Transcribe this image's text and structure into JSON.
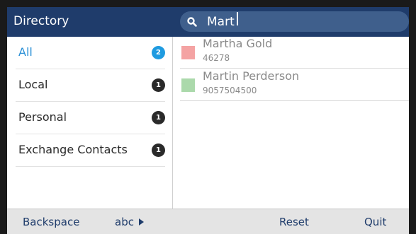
{
  "header": {
    "title": "Directory"
  },
  "search": {
    "value": "Mart",
    "icon": "search-icon"
  },
  "sidebar": {
    "items": [
      {
        "label": "All",
        "count": "2",
        "active": true
      },
      {
        "label": "Local",
        "count": "1",
        "active": false
      },
      {
        "label": "Personal",
        "count": "1",
        "active": false
      },
      {
        "label": "Exchange Contacts",
        "count": "1",
        "active": false
      }
    ]
  },
  "results": [
    {
      "name": "Martha Gold",
      "number": "46278",
      "color": "#f4a3a3"
    },
    {
      "name": "Martin Perderson",
      "number": "9057504500",
      "color": "#abd9ab"
    }
  ],
  "softkeys": {
    "backspace": "Backspace",
    "abc": "abc",
    "reset": "Reset",
    "quit": "Quit"
  },
  "colors": {
    "header_bg": "#1f3c6b",
    "accent": "#2a8fd6",
    "badge_active": "#1f9be0"
  }
}
